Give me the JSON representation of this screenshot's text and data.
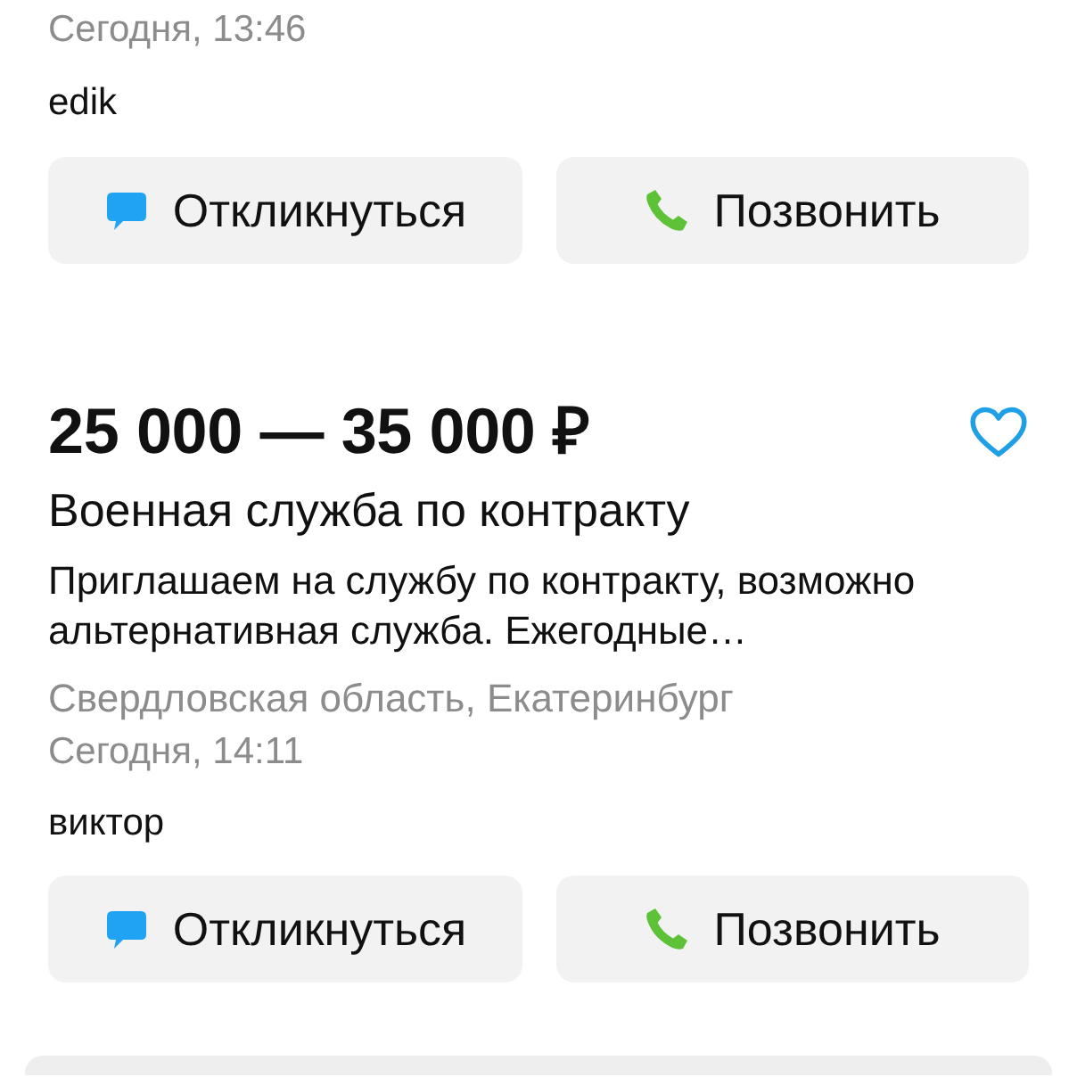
{
  "listings": [
    {
      "date": "Сегодня, 13:46",
      "author": "edik",
      "actions": [
        {
          "kind": "respond",
          "label": "Откликнуться"
        },
        {
          "kind": "call",
          "label": "Позвонить"
        }
      ]
    },
    {
      "price": "25 000 — 35 000 ₽",
      "favorite": false,
      "title": "Военная служба по контракту",
      "description": "Приглашаем на службу по контракту, возможно альтернативная служба. Ежегодные…",
      "location": "Свердловская область, Екатеринбург",
      "date": "Сегодня, 14:11",
      "author": "виктор",
      "actions": [
        {
          "kind": "respond",
          "label": "Откликнуться"
        },
        {
          "kind": "call",
          "label": "Позвонить"
        }
      ]
    }
  ]
}
